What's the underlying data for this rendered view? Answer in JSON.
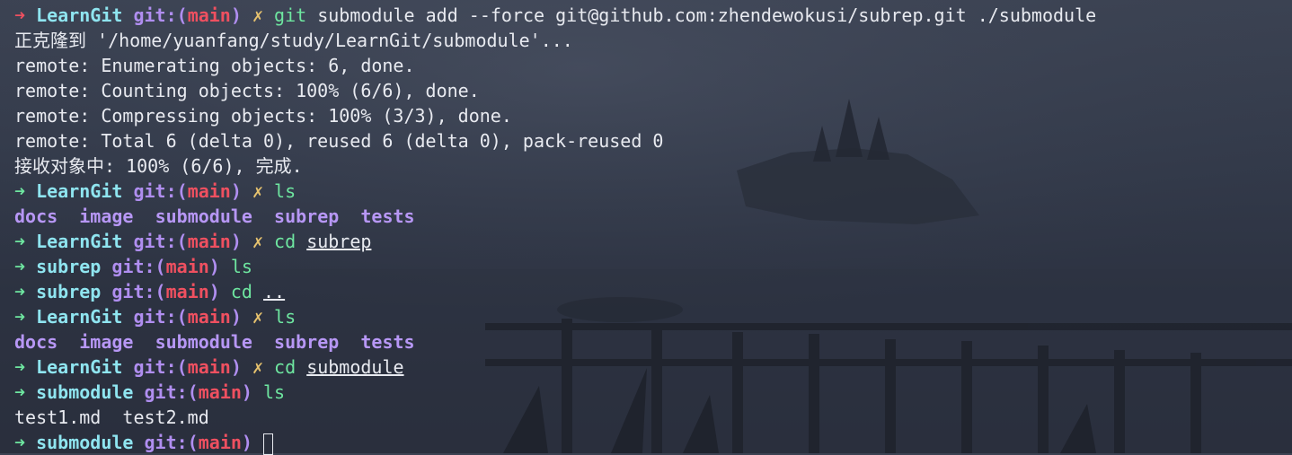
{
  "lines": [
    {
      "type": "prompt",
      "arrow": "➜",
      "status": "error",
      "dir": "LearnGit",
      "git_label": "git:(",
      "branch": "main",
      "git_close": ")",
      "dirty": "✗",
      "cmd": "git",
      "args": "submodule add --force git@github.com:zhendewokusi/subrep.git ./submodule",
      "path": ""
    },
    {
      "type": "output",
      "text": "正克隆到 '/home/yuanfang/study/LearnGit/submodule'..."
    },
    {
      "type": "output",
      "text": "remote: Enumerating objects: 6, done."
    },
    {
      "type": "output",
      "text": "remote: Counting objects: 100% (6/6), done."
    },
    {
      "type": "output",
      "text": "remote: Compressing objects: 100% (3/3), done."
    },
    {
      "type": "output",
      "text": "remote: Total 6 (delta 0), reused 6 (delta 0), pack-reused 0"
    },
    {
      "type": "output",
      "text": "接收对象中: 100% (6/6), 完成."
    },
    {
      "type": "prompt",
      "arrow": "➜",
      "status": "ok",
      "dir": "LearnGit",
      "git_label": "git:(",
      "branch": "main",
      "git_close": ")",
      "dirty": "✗",
      "cmd": "ls",
      "args": "",
      "path": ""
    },
    {
      "type": "ls",
      "items": [
        "docs",
        "image",
        "submodule",
        "subrep",
        "tests"
      ]
    },
    {
      "type": "prompt",
      "arrow": "➜",
      "status": "ok",
      "dir": "LearnGit",
      "git_label": "git:(",
      "branch": "main",
      "git_close": ")",
      "dirty": "✗",
      "cmd": "cd",
      "args": "",
      "path": "subrep"
    },
    {
      "type": "prompt",
      "arrow": "➜",
      "status": "ok",
      "dir": "subrep",
      "git_label": "git:(",
      "branch": "main",
      "git_close": ")",
      "dirty": "",
      "cmd": "ls",
      "args": "",
      "path": ""
    },
    {
      "type": "prompt",
      "arrow": "➜",
      "status": "ok",
      "dir": "subrep",
      "git_label": "git:(",
      "branch": "main",
      "git_close": ")",
      "dirty": "",
      "cmd": "cd",
      "args": "",
      "path": ".."
    },
    {
      "type": "prompt",
      "arrow": "➜",
      "status": "ok",
      "dir": "LearnGit",
      "git_label": "git:(",
      "branch": "main",
      "git_close": ")",
      "dirty": "✗",
      "cmd": "ls",
      "args": "",
      "path": ""
    },
    {
      "type": "ls",
      "items": [
        "docs",
        "image",
        "submodule",
        "subrep",
        "tests"
      ]
    },
    {
      "type": "prompt",
      "arrow": "➜",
      "status": "ok",
      "dir": "LearnGit",
      "git_label": "git:(",
      "branch": "main",
      "git_close": ")",
      "dirty": "✗",
      "cmd": "cd",
      "args": "",
      "path": "submodule"
    },
    {
      "type": "prompt",
      "arrow": "➜",
      "status": "ok",
      "dir": "submodule",
      "git_label": "git:(",
      "branch": "main",
      "git_close": ")",
      "dirty": "",
      "cmd": "ls",
      "args": "",
      "path": ""
    },
    {
      "type": "output",
      "text": "test1.md  test2.md"
    },
    {
      "type": "prompt",
      "arrow": "➜",
      "status": "ok",
      "dir": "submodule",
      "git_label": "git:(",
      "branch": "main",
      "git_close": ")",
      "dirty": "",
      "cmd": "",
      "args": "",
      "path": "",
      "cursor": true
    }
  ]
}
